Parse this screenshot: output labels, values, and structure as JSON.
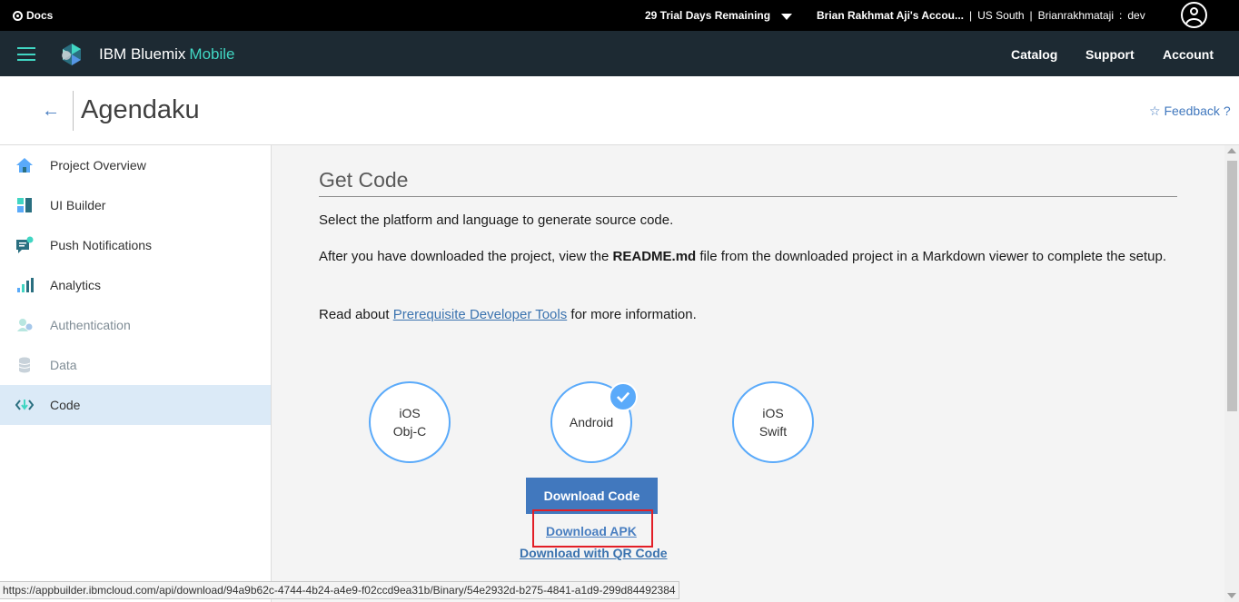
{
  "topbar": {
    "docs_label": "Docs",
    "trial_label": "29 Trial Days Remaining",
    "account_name": "Brian Rakhmat Aji's Accou...",
    "region": "US South",
    "org": "Brianrakhmataji",
    "space": "dev",
    "separator": ":",
    "divider": "|"
  },
  "header": {
    "brand": "IBM Bluemix",
    "brand_accent": "Mobile",
    "nav": [
      "Catalog",
      "Support",
      "Account"
    ]
  },
  "page": {
    "title": "Agendaku",
    "feedback": "☆ Feedback ?"
  },
  "sidebar": {
    "items": [
      {
        "label": "Project Overview",
        "icon": "home-icon"
      },
      {
        "label": "UI Builder",
        "icon": "ui-builder-icon"
      },
      {
        "label": "Push Notifications",
        "icon": "push-notifications-icon"
      },
      {
        "label": "Analytics",
        "icon": "analytics-icon"
      },
      {
        "label": "Authentication",
        "icon": "authentication-icon"
      },
      {
        "label": "Data",
        "icon": "data-icon"
      },
      {
        "label": "Code",
        "icon": "code-icon"
      }
    ],
    "active": "Code"
  },
  "main": {
    "section_title": "Get Code",
    "intro": "Select the platform and language to generate source code.",
    "readme_before": "After you have downloaded the project, view the ",
    "readme_file": "README.md",
    "readme_after": " file from the downloaded project in a Markdown viewer to complete the setup.",
    "read_before": "Read about ",
    "read_link": "Prerequisite Developer Tools",
    "read_after": " for more information.",
    "platforms": [
      {
        "line1": "iOS",
        "line2": "Obj-C"
      },
      {
        "line1": "Android",
        "line2": ""
      },
      {
        "line1": "iOS",
        "line2": "Swift"
      }
    ],
    "selected_platform": "Android",
    "download_code": "Download Code",
    "download_apk": "Download APK",
    "download_qr": "Download with QR Code"
  },
  "status_bar": {
    "url": "https://appbuilder.ibmcloud.com/api/download/94a9b62c-4744-4b24-a4e9-f02ccd9ea31b/Binary/54e2932d-b275-4841-a1d9-299d84492384"
  },
  "colors": {
    "accent": "#41d6c3",
    "primary": "#4178be",
    "header_bg": "#1d2a33",
    "highlight_red": "#e21e26"
  }
}
